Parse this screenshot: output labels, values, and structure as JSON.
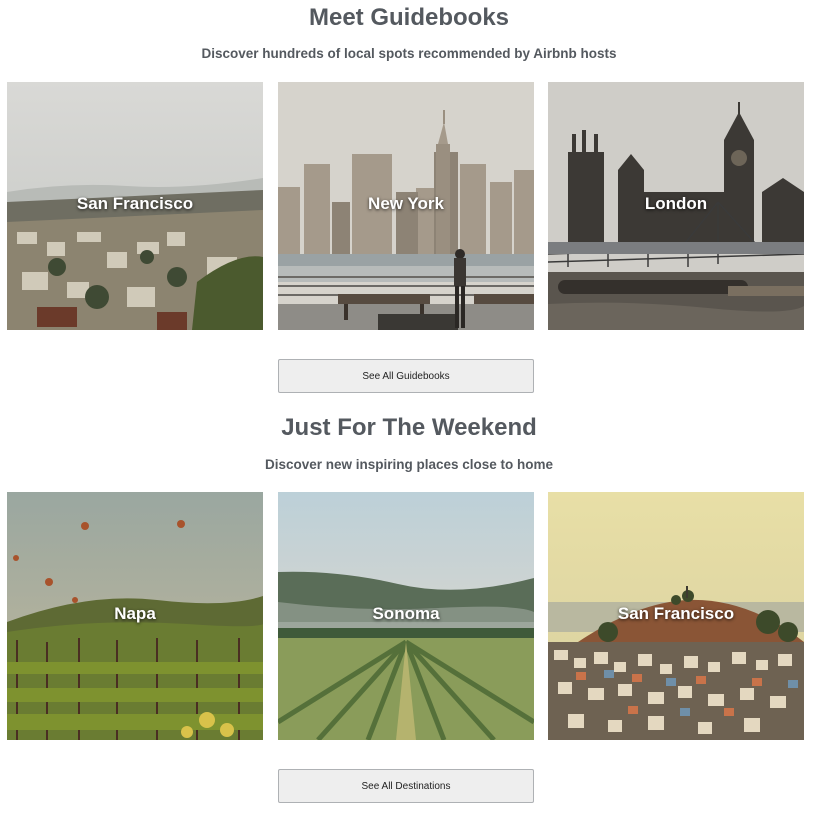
{
  "guidebooks": {
    "heading": "Meet Guidebooks",
    "subheading": "Discover hundreds of local spots recommended by Airbnb hosts",
    "cards": [
      {
        "label": "San Francisco",
        "image": "san-francisco-hillside-city"
      },
      {
        "label": "New York",
        "image": "new-york-skyline-waterfront"
      },
      {
        "label": "London",
        "image": "london-big-ben-thames"
      }
    ],
    "button_label": "See All Guidebooks"
  },
  "weekend": {
    "heading": "Just For The Weekend",
    "subheading": "Discover new inspiring places close to home",
    "cards": [
      {
        "label": "Napa",
        "image": "napa-vineyard-hot-air-balloons"
      },
      {
        "label": "Sonoma",
        "image": "sonoma-vineyard-rows-hills"
      },
      {
        "label": "San Francisco",
        "image": "san-francisco-hill-houses-sunset"
      }
    ],
    "button_label": "See All Destinations"
  }
}
